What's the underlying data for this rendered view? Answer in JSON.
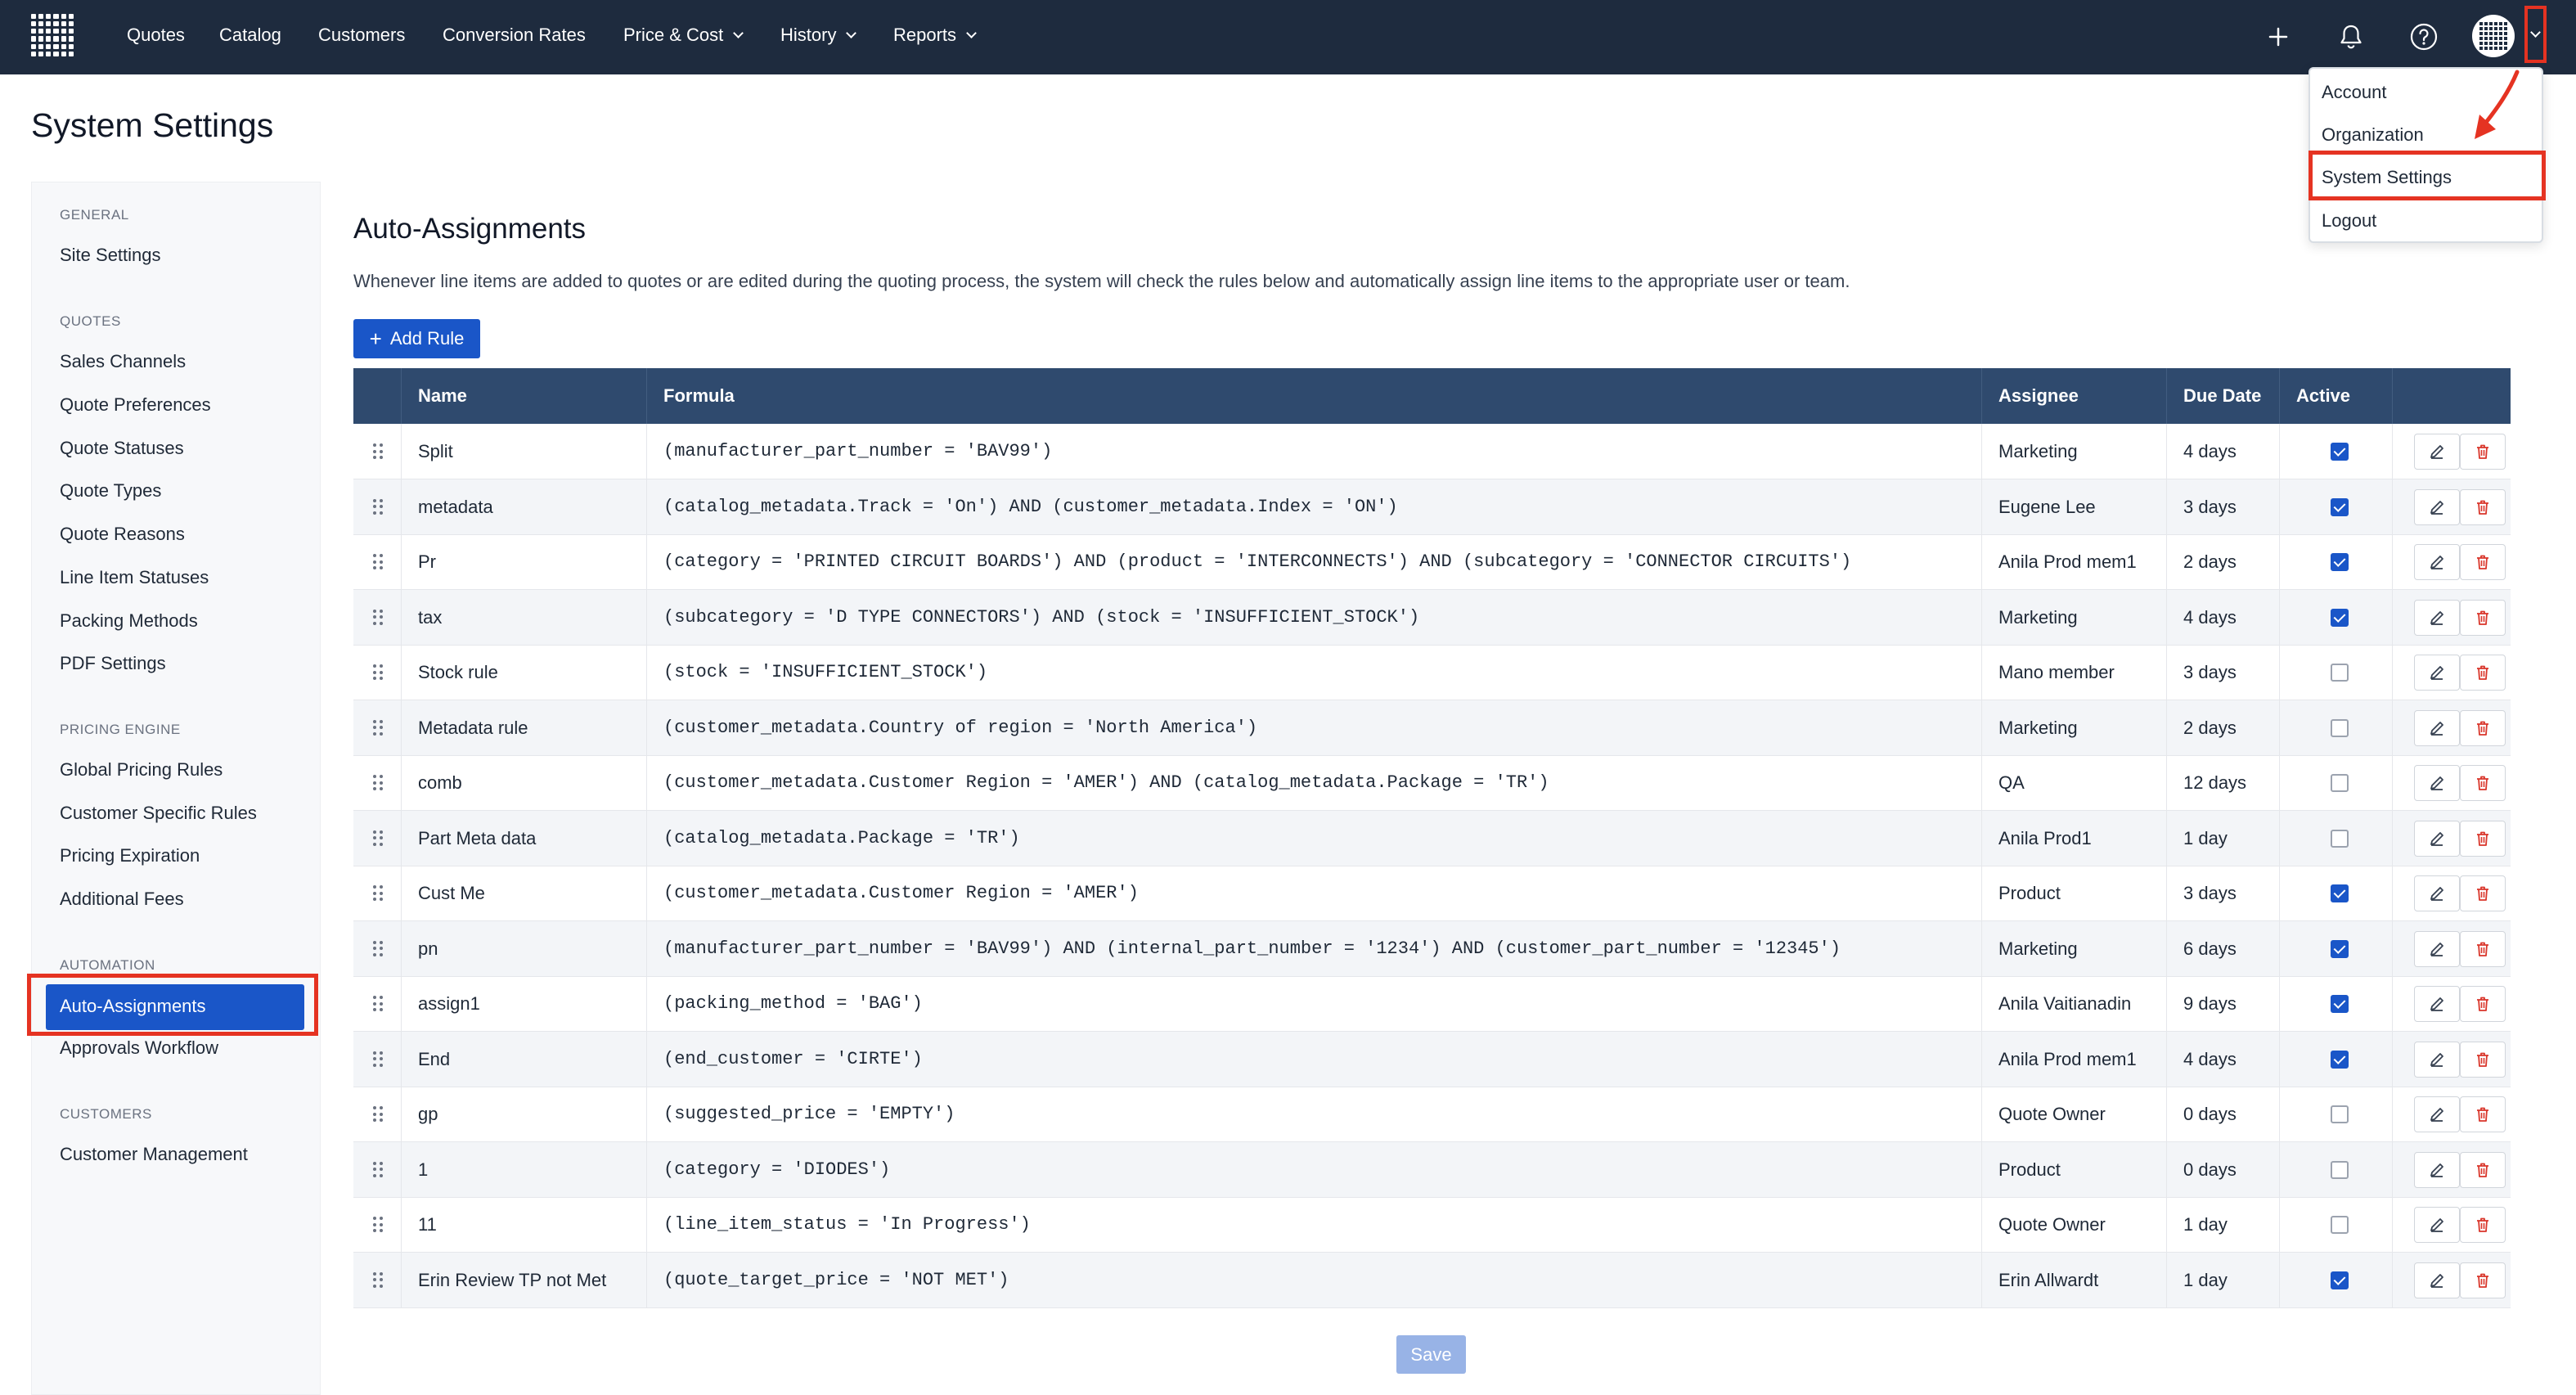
{
  "nav": {
    "items": [
      "Quotes",
      "Catalog",
      "Customers",
      "Conversion Rates",
      "Price & Cost",
      "History",
      "Reports"
    ],
    "icons": [
      "plus-icon",
      "bell-icon",
      "help-icon"
    ]
  },
  "user_menu": {
    "items": [
      "Account",
      "Organization",
      "System Settings",
      "Logout"
    ]
  },
  "page": {
    "title": "System Settings"
  },
  "sidebar": {
    "sections": [
      {
        "heading": "GENERAL",
        "items": [
          "Site Settings"
        ]
      },
      {
        "heading": "QUOTES",
        "items": [
          "Sales Channels",
          "Quote Preferences",
          "Quote Statuses",
          "Quote Types",
          "Quote Reasons",
          "Line Item Statuses",
          "Packing Methods",
          "PDF Settings"
        ]
      },
      {
        "heading": "PRICING ENGINE",
        "items": [
          "Global Pricing Rules",
          "Customer Specific Rules",
          "Pricing Expiration",
          "Additional Fees"
        ]
      },
      {
        "heading": "AUTOMATION",
        "items": [
          "Auto-Assignments",
          "Approvals Workflow"
        ]
      },
      {
        "heading": "CUSTOMERS",
        "items": [
          "Customer Management"
        ]
      }
    ],
    "active": "Auto-Assignments"
  },
  "main": {
    "title": "Auto-Assignments",
    "description": "Whenever line items are added to quotes or are edited during the quoting process, the system will check the rules below and automatically assign line items to the appropriate user or team.",
    "add_button": "Add Rule",
    "save_button": "Save",
    "columns": [
      "Name",
      "Formula",
      "Assignee",
      "Due Date",
      "Active"
    ],
    "rules": [
      {
        "name": "Split",
        "formula": "(manufacturer_part_number = 'BAV99')",
        "assignee": "Marketing",
        "due": "4 days",
        "active": true
      },
      {
        "name": "metadata",
        "formula": "(catalog_metadata.Track = 'On') AND (customer_metadata.Index = 'ON')",
        "assignee": "Eugene Lee",
        "due": "3 days",
        "active": true
      },
      {
        "name": "Pr",
        "formula": "(category = 'PRINTED CIRCUIT BOARDS') AND (product = 'INTERCONNECTS') AND (subcategory = 'CONNECTOR CIRCUITS')",
        "assignee": "Anila Prod mem1",
        "due": "2 days",
        "active": true
      },
      {
        "name": "tax",
        "formula": "(subcategory = 'D TYPE CONNECTORS') AND (stock = 'INSUFFICIENT_STOCK')",
        "assignee": "Marketing",
        "due": "4 days",
        "active": true
      },
      {
        "name": "Stock rule",
        "formula": "(stock = 'INSUFFICIENT_STOCK')",
        "assignee": "Mano member",
        "due": "3 days",
        "active": false
      },
      {
        "name": "Metadata rule",
        "formula": "(customer_metadata.Country of region = 'North America')",
        "assignee": "Marketing",
        "due": "2 days",
        "active": false
      },
      {
        "name": "comb",
        "formula": "(customer_metadata.Customer Region = 'AMER') AND (catalog_metadata.Package = 'TR')",
        "assignee": "QA",
        "due": "12 days",
        "active": false
      },
      {
        "name": "Part Meta data",
        "formula": "(catalog_metadata.Package = 'TR')",
        "assignee": "Anila Prod1",
        "due": "1 day",
        "active": false
      },
      {
        "name": "Cust Me",
        "formula": "(customer_metadata.Customer Region = 'AMER')",
        "assignee": "Product",
        "due": "3 days",
        "active": true
      },
      {
        "name": "pn",
        "formula": "(manufacturer_part_number = 'BAV99') AND (internal_part_number = '1234') AND (customer_part_number = '12345')",
        "assignee": "Marketing",
        "due": "6 days",
        "active": true
      },
      {
        "name": "assign1",
        "formula": "(packing_method = 'BAG')",
        "assignee": "Anila Vaitianadin",
        "due": "9 days",
        "active": true
      },
      {
        "name": "End",
        "formula": "(end_customer = 'CIRTE')",
        "assignee": "Anila Prod mem1",
        "due": "4 days",
        "active": true
      },
      {
        "name": "gp",
        "formula": "(suggested_price = 'EMPTY')",
        "assignee": "Quote Owner",
        "due": "0 days",
        "active": false
      },
      {
        "name": "1",
        "formula": "(category = 'DIODES')",
        "assignee": "Product",
        "due": "0 days",
        "active": false
      },
      {
        "name": "11",
        "formula": "(line_item_status = 'In Progress')",
        "assignee": "Quote Owner",
        "due": "1 day",
        "active": false
      },
      {
        "name": "Erin Review TP not Met",
        "formula": "(quote_target_price = 'NOT MET')",
        "assignee": "Erin Allwardt",
        "due": "1 day",
        "active": true
      }
    ]
  },
  "colors": {
    "nav_bg": "#1e2b3e",
    "primary": "#1a56c8",
    "header_bg": "#2f4a6e",
    "annotation": "#e53322"
  }
}
